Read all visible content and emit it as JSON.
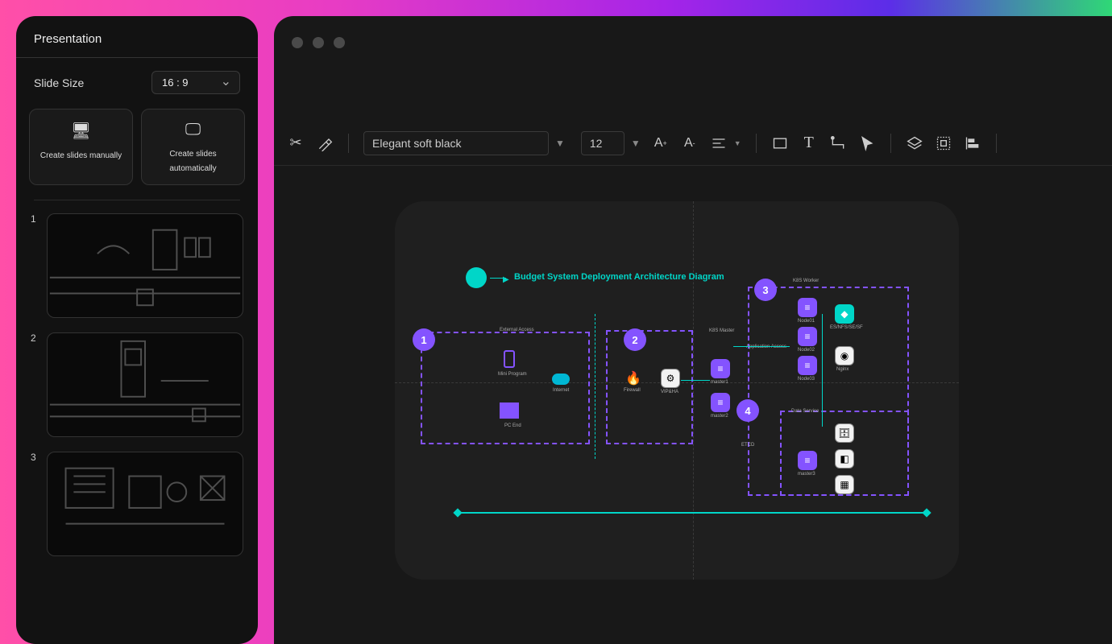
{
  "sidebar": {
    "title": "Presentation",
    "slide_size_label": "Slide Size",
    "slide_size_value": "16 : 9",
    "create_manual": "Create slides manually",
    "create_auto": "Create slides automatically",
    "thumbs": [
      "1",
      "2",
      "3"
    ]
  },
  "toolbar": {
    "font_name": "Elegant soft black",
    "font_size": "12"
  },
  "diagram": {
    "title": "Budget System Deployment Architecture Diagram",
    "badges": {
      "b1": "1",
      "b2": "2",
      "b3": "3",
      "b4": "4"
    },
    "labels": {
      "external_access": "External Access",
      "mini_program": "Mini Program",
      "pc_end": "PC End",
      "internet": "Internet",
      "firewall": "Firewall",
      "vip_ha": "VIP&HA",
      "k8s_master": "K8S Master",
      "master1": "master1",
      "master2": "master2",
      "k8s_worker": "K8S Worker",
      "application_access": "Application Access",
      "node01": "Node01",
      "node02": "Node02",
      "node03": "Node03",
      "es_ms": "ES/NFS/SE/SF",
      "nginx": "Nginx",
      "data_service": "Data Service",
      "etcd": "ETCD",
      "master3": "master3"
    }
  }
}
